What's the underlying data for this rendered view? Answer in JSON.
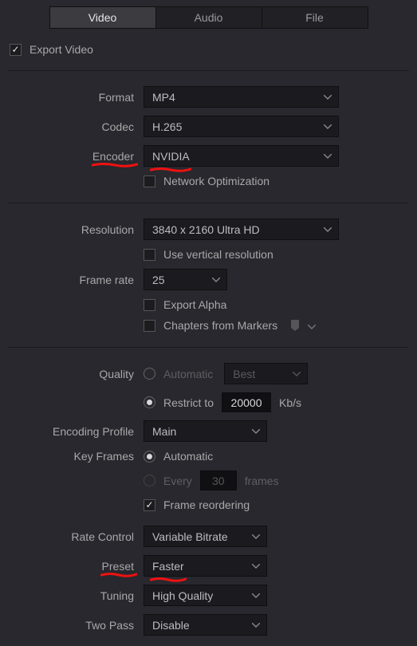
{
  "tabs": {
    "video": "Video",
    "audio": "Audio",
    "file": "File"
  },
  "export": {
    "label": "Export Video",
    "checked": true
  },
  "video": {
    "format_label": "Format",
    "format_value": "MP4",
    "codec_label": "Codec",
    "codec_value": "H.265",
    "encoder_label": "Encoder",
    "encoder_value": "NVIDIA",
    "network_opt_label": "Network Optimization",
    "resolution_label": "Resolution",
    "resolution_value": "3840 x 2160 Ultra HD",
    "use_vertical_label": "Use vertical resolution",
    "frame_rate_label": "Frame rate",
    "frame_rate_value": "25",
    "export_alpha_label": "Export Alpha",
    "chapters_label": "Chapters from Markers",
    "quality_label": "Quality",
    "quality_auto_label": "Automatic",
    "quality_best_value": "Best",
    "quality_restrict_label": "Restrict to",
    "quality_restrict_value": "20000",
    "quality_unit": "Kb/s",
    "encoding_profile_label": "Encoding Profile",
    "encoding_profile_value": "Main",
    "keyframes_label": "Key Frames",
    "keyframes_auto_label": "Automatic",
    "keyframes_every_label": "Every",
    "keyframes_every_value": "30",
    "keyframes_unit": "frames",
    "frame_reorder_label": "Frame reordering",
    "rate_control_label": "Rate Control",
    "rate_control_value": "Variable Bitrate",
    "preset_label": "Preset",
    "preset_value": "Faster",
    "tuning_label": "Tuning",
    "tuning_value": "High Quality",
    "two_pass_label": "Two Pass",
    "two_pass_value": "Disable"
  },
  "annotations": {
    "encoder_label": true,
    "encoder_value": true,
    "preset_label": true,
    "preset_value": true
  }
}
